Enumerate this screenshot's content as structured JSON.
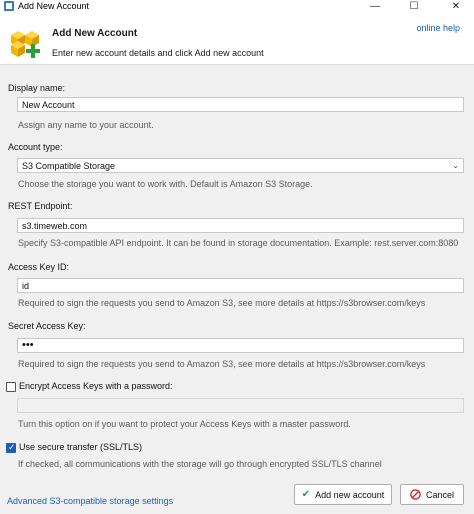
{
  "window": {
    "title": "Add New Account",
    "minimize_glyph": "—",
    "maximize_glyph": "☐",
    "close_glyph": "✕"
  },
  "header": {
    "title": "Add New Account",
    "subtitle": "Enter new account details and click Add new account",
    "online_help": "online help",
    "icon": "cubes-add-icon"
  },
  "form": {
    "display_name": {
      "label": "Display name:",
      "value": "New Account",
      "hint": "Assign any name to your account."
    },
    "account_type": {
      "label": "Account type:",
      "value": "S3 Compatible Storage",
      "hint": "Choose the storage you want to work with. Default is Amazon S3 Storage."
    },
    "rest_endpoint": {
      "label": "REST Endpoint:",
      "value": "s3.timeweb.com",
      "hint": "Specify S3-compatible API endpoint. It can be found in storage documentation. Example: rest.server.com:8080"
    },
    "access_key_id": {
      "label": "Access Key ID:",
      "value": "id",
      "hint": "Required to sign the requests you send to Amazon S3, see more details at https://s3browser.com/keys"
    },
    "secret_access_key": {
      "label": "Secret Access Key:",
      "value": "•••",
      "hint": "Required to sign the requests you send to Amazon S3, see more details at https://s3browser.com/keys"
    },
    "encrypt_keys": {
      "label": "Encrypt Access Keys with a password:",
      "checked": false,
      "value": "",
      "hint": "Turn this option on if you want to protect your Access Keys with a master password."
    },
    "secure_transfer": {
      "label": "Use secure transfer (SSL/TLS)",
      "checked": true,
      "hint": "If checked, all communications with the storage will go through encrypted SSL/TLS channel"
    }
  },
  "footer": {
    "advanced_link": "Advanced S3-compatible storage settings",
    "add_button": "Add new account",
    "cancel_button": "Cancel"
  },
  "colors": {
    "link": "#1a5fb4",
    "checkbox_checked": "#1a5fb4",
    "cancel_icon": "#d32f2f",
    "add_icon": "#2e9d3a"
  }
}
